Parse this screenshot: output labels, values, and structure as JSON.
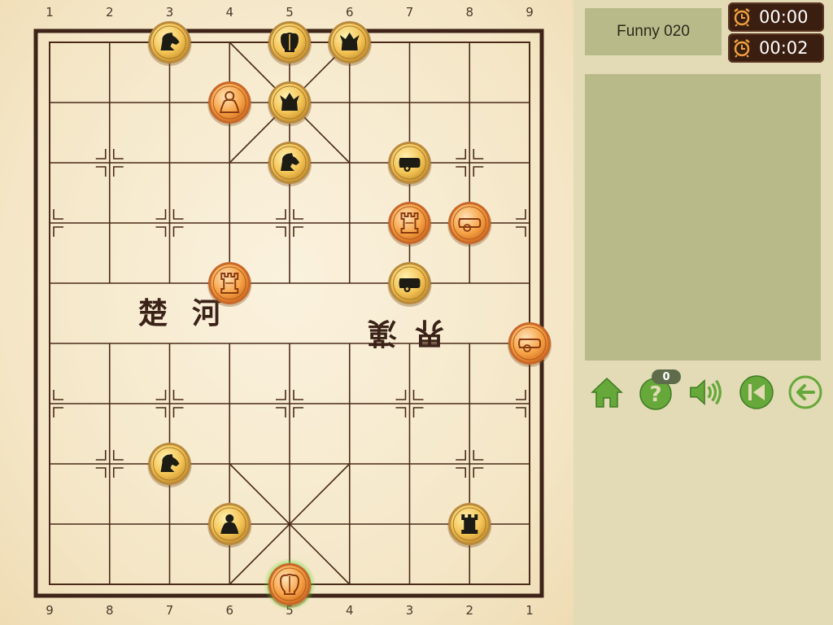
{
  "game": {
    "level_title": "Funny 020",
    "timers": [
      {
        "time": "00:00"
      },
      {
        "time": "00:02"
      }
    ],
    "hint_count": "0"
  },
  "board": {
    "top_files": [
      "1",
      "2",
      "3",
      "4",
      "5",
      "6",
      "7",
      "8",
      "9"
    ],
    "bottom_files": [
      "9",
      "8",
      "7",
      "6",
      "5",
      "4",
      "3",
      "2",
      "1"
    ],
    "river_left": [
      "楚",
      "河"
    ],
    "river_right": [
      "漢",
      "界"
    ],
    "pieces": [
      {
        "name": "black-horse",
        "side": "black",
        "type": "horse",
        "file": 2,
        "rank": 0
      },
      {
        "name": "black-general",
        "side": "black",
        "type": "general",
        "file": 4,
        "rank": 0
      },
      {
        "name": "black-advisor",
        "side": "black",
        "type": "advisor",
        "file": 5,
        "rank": 0
      },
      {
        "name": "red-advisor",
        "side": "red",
        "type": "advisor",
        "file": 3,
        "rank": 1
      },
      {
        "name": "black-advisor",
        "side": "black",
        "type": "advisor",
        "file": 4,
        "rank": 1
      },
      {
        "name": "black-horse",
        "side": "black",
        "type": "horse",
        "file": 4,
        "rank": 2
      },
      {
        "name": "black-cannon",
        "side": "black",
        "type": "cannon",
        "file": 6,
        "rank": 2
      },
      {
        "name": "red-chariot",
        "side": "red",
        "type": "chariot",
        "file": 6,
        "rank": 3
      },
      {
        "name": "red-cannon",
        "side": "red",
        "type": "cannon",
        "file": 7,
        "rank": 3
      },
      {
        "name": "red-chariot",
        "side": "red",
        "type": "chariot",
        "file": 3,
        "rank": 4
      },
      {
        "name": "black-cannon",
        "side": "black",
        "type": "cannon",
        "file": 6,
        "rank": 4
      },
      {
        "name": "red-cannon",
        "side": "red",
        "type": "cannon",
        "file": 8,
        "rank": 5
      },
      {
        "name": "black-horse",
        "side": "black",
        "type": "horse",
        "file": 2,
        "rank": 7
      },
      {
        "name": "black-soldier",
        "side": "black",
        "type": "soldier",
        "file": 3,
        "rank": 8
      },
      {
        "name": "black-chariot",
        "side": "black",
        "type": "chariot",
        "file": 7,
        "rank": 8
      },
      {
        "name": "red-general",
        "side": "red",
        "type": "general",
        "file": 4,
        "rank": 9,
        "selected": true
      }
    ]
  },
  "toolbar": [
    {
      "name": "home-button",
      "icon": "home-icon"
    },
    {
      "name": "hint-button",
      "icon": "question-icon"
    },
    {
      "name": "sound-button",
      "icon": "speaker-icon"
    },
    {
      "name": "restart-button",
      "icon": "skip-back-icon"
    },
    {
      "name": "undo-button",
      "icon": "arrow-left-icon"
    }
  ],
  "colors": {
    "board_line": "#4a2a18",
    "panel_box": "#b9ba8a",
    "toolbar_green": "#66a83a",
    "black_piece_fill": "#f4c456",
    "red_piece_fill": "#f6a346",
    "selection_glow": "#5dd62c"
  }
}
